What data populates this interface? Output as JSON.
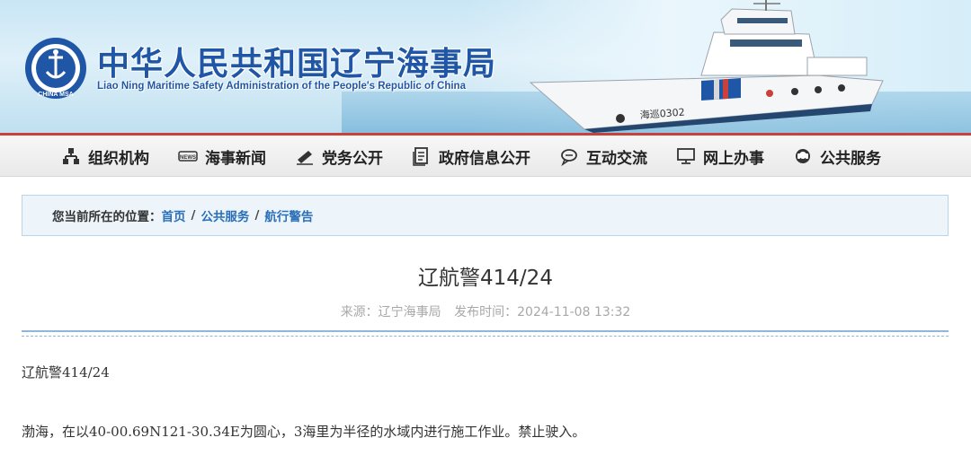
{
  "header": {
    "title_cn": "中华人民共和国辽宁海事局",
    "title_en": "Liao Ning Maritime Safety Administration of the People's Republic of China",
    "logo_text": "CHINA MSA",
    "ship_name": "海巡0302",
    "brand_color": "#1f56a6"
  },
  "nav": {
    "accent_color": "#c9413a",
    "items": [
      {
        "label": "组织机构",
        "icon": "org-chart-icon"
      },
      {
        "label": "海事新闻",
        "icon": "news-icon"
      },
      {
        "label": "党务公开",
        "icon": "pen-icon"
      },
      {
        "label": "政府信息公开",
        "icon": "document-icon"
      },
      {
        "label": "互动交流",
        "icon": "chat-icon"
      },
      {
        "label": "网上办事",
        "icon": "monitor-icon"
      },
      {
        "label": "公共服务",
        "icon": "service-icon"
      }
    ]
  },
  "breadcrumb": {
    "label": "您当前所在的位置：",
    "items": [
      "首页",
      "公共服务",
      "航行警告"
    ],
    "separator": "/"
  },
  "article": {
    "title": "辽航警414/24",
    "source": "来源：辽宁海事局",
    "published": "发布时间：2024-11-08 13:32",
    "paragraphs": [
      "辽航警414/24",
      "渤海，在以40-00.69N121-30.34E为圆心，3海里为半径的水域内进行施工作业。禁止驶入。"
    ]
  }
}
